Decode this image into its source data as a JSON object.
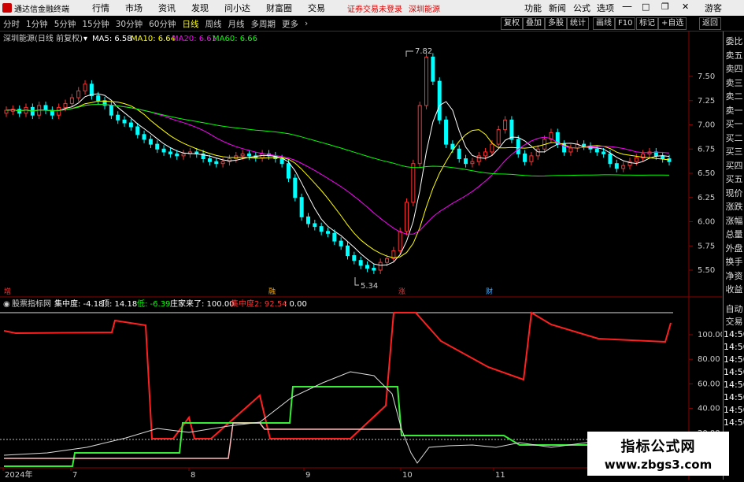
{
  "menubar": {
    "app_name": "通达信金融终端",
    "items": [
      "行情",
      "市场",
      "资讯",
      "发现",
      "问小达",
      "财富圈",
      "交易"
    ],
    "alert": "证券交易未登录",
    "stock_link": "深圳能源",
    "right_items": [
      "功能",
      "新闻",
      "公式",
      "选项",
      "游客"
    ]
  },
  "tabs": [
    "分时",
    "1分钟",
    "5分钟",
    "15分钟",
    "30分钟",
    "60分钟",
    "日线",
    "周线",
    "月线",
    "多周期",
    "更多"
  ],
  "active_tab": "日线",
  "toolbar_right": [
    "复权",
    "叠加",
    "多股",
    "统计",
    "画线",
    "F10",
    "标记",
    "+自选",
    "返回"
  ],
  "price_panel": {
    "title": "深圳能源(日线 前复权)",
    "ma": [
      {
        "label": "MA5: 6.58",
        "color": "#ffffff"
      },
      {
        "label": "MA10: 6.64",
        "color": "#ffff00"
      },
      {
        "label": "MA20: 6.61",
        "color": "#ff00ff"
      },
      {
        "label": "MA60: 6.66",
        "color": "#00ff00"
      }
    ],
    "y_ticks": [
      "7.50",
      "7.25",
      "7.00",
      "6.75",
      "6.50",
      "6.25",
      "6.00",
      "5.75",
      "5.50"
    ],
    "high_label": "7.82",
    "low_label": "5.34",
    "markers": [
      "增",
      "融",
      "涨",
      "财"
    ]
  },
  "indicator_panel": {
    "title": "股票指标网",
    "values": [
      {
        "label": "集中度: -4.18",
        "color": "#ffffff"
      },
      {
        "label": "顶: 14.18",
        "color": "#ffffff"
      },
      {
        "label": "低: -6.39",
        "color": "#00ff00"
      },
      {
        "label": "庄家来了: 100.00",
        "color": "#ffffff"
      },
      {
        "label": "集中度2: 92.54",
        "color": "#ff3030"
      },
      {
        "label": ": 0.00",
        "color": "#ffffff"
      }
    ],
    "y_ticks": [
      "100.00",
      "80.00",
      "60.00",
      "40.00",
      "20.00"
    ]
  },
  "x_axis": [
    "2024年",
    "7",
    "8",
    "9",
    "10",
    "11"
  ],
  "side_panel": {
    "top": [
      "委比",
      "卖五",
      "卖四",
      "卖三",
      "卖二",
      "卖一",
      "买一",
      "买二",
      "买三",
      "买四",
      "买五",
      "现价",
      "涨跌",
      "涨幅",
      "总量",
      "外盘",
      "换手",
      "净资",
      "收益"
    ],
    "bottom": [
      "自动",
      "交易",
      "14:50",
      "14:50",
      "14:50",
      "14:50",
      "14:50",
      "14:50",
      "14:50",
      "14:50"
    ]
  },
  "watermark": {
    "line1": "指标公式网",
    "line2": "www.zbgs3.com"
  }
}
